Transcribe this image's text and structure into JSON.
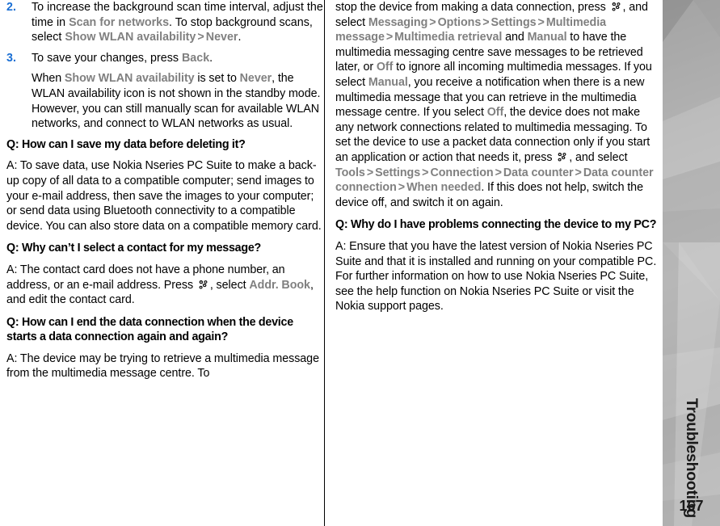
{
  "sidebar": {
    "chapter_title": "Troubleshooting",
    "page_number": "167",
    "icon": "faceted-gray-tab"
  },
  "document": {
    "icons": {
      "menu_key": "nokia-menu-key-icon"
    },
    "left_column": {
      "steps": [
        {
          "number": "2.",
          "parts": [
            {
              "type": "text",
              "value": "To increase the background scan time interval, adjust the time in "
            },
            {
              "type": "ui",
              "value": "Scan for networks"
            },
            {
              "type": "text",
              "value": ". To stop background scans, select "
            },
            {
              "type": "ui",
              "value": "Show WLAN availability"
            },
            {
              "type": "arrow",
              "value": ">"
            },
            {
              "type": "ui",
              "value": "Never"
            },
            {
              "type": "text",
              "value": "."
            }
          ]
        },
        {
          "number": "3.",
          "parts": [
            {
              "type": "text",
              "value": "To save your changes, press "
            },
            {
              "type": "ui",
              "value": "Back"
            },
            {
              "type": "text",
              "value": "."
            }
          ]
        }
      ],
      "step_note": [
        {
          "type": "text",
          "value": "When "
        },
        {
          "type": "ui",
          "value": "Show WLAN availability"
        },
        {
          "type": "text",
          "value": " is set to "
        },
        {
          "type": "ui",
          "value": "Never"
        },
        {
          "type": "text",
          "value": ", the WLAN availability icon is not shown in the standby mode. However, you can still manually scan for available WLAN networks, and connect to WLAN networks as usual."
        }
      ],
      "qa": [
        {
          "question": "Q: How can I save my data before deleting it?",
          "answer": [
            {
              "type": "text",
              "value": "A: To save data, use Nokia Nseries PC Suite to make a back-up copy of all data to a compatible computer; send images to your e-mail address, then save the images to your computer; or send data using Bluetooth connectivity to a compatible device. You can also store data on a compatible memory card."
            }
          ]
        },
        {
          "question": "Q: Why can’t I select a contact for my message?",
          "answer": [
            {
              "type": "text",
              "value": "A: The contact card does not have a phone number, an address, or an e-mail address. Press "
            },
            {
              "type": "icon",
              "value": "menu-key-icon"
            },
            {
              "type": "text",
              "value": ", select "
            },
            {
              "type": "ui",
              "value": "Addr. Book"
            },
            {
              "type": "text",
              "value": ", and edit the contact card."
            }
          ]
        },
        {
          "question": "Q: How can I end the data connection when the device starts a data connection again and again?",
          "answer": [
            {
              "type": "text",
              "value": "A: The device may be trying to retrieve a multimedia message from the multimedia message centre. To"
            }
          ]
        }
      ]
    },
    "right_column": {
      "continuation": [
        {
          "type": "text",
          "value": "stop the device from making a data connection, press "
        },
        {
          "type": "icon",
          "value": "menu-key-icon"
        },
        {
          "type": "text",
          "value": ", and select "
        },
        {
          "type": "ui",
          "value": "Messaging"
        },
        {
          "type": "arrow",
          "value": ">"
        },
        {
          "type": "ui",
          "value": "Options"
        },
        {
          "type": "arrow",
          "value": ">"
        },
        {
          "type": "ui",
          "value": "Settings"
        },
        {
          "type": "arrow",
          "value": ">"
        },
        {
          "type": "ui",
          "value": "Multimedia message"
        },
        {
          "type": "arrow",
          "value": ">"
        },
        {
          "type": "ui",
          "value": "Multimedia retrieval"
        },
        {
          "type": "text",
          "value": " and "
        },
        {
          "type": "ui",
          "value": "Manual"
        },
        {
          "type": "text",
          "value": " to have the multimedia messaging centre save messages to be retrieved later, or "
        },
        {
          "type": "ui",
          "value": "Off"
        },
        {
          "type": "text",
          "value": " to ignore all incoming multimedia messages. If you select "
        },
        {
          "type": "ui",
          "value": "Manual"
        },
        {
          "type": "text",
          "value": ", you receive a notification when there is a new multimedia message that you can retrieve in the multimedia message centre. If you select "
        },
        {
          "type": "ui",
          "value": "Off"
        },
        {
          "type": "text",
          "value": ", the device does not make any network connections related to multimedia messaging. To set the device to use a packet data connection only if you start an application or action that needs it, press "
        },
        {
          "type": "icon",
          "value": "menu-key-icon"
        },
        {
          "type": "text",
          "value": ", and select "
        },
        {
          "type": "ui",
          "value": "Tools"
        },
        {
          "type": "arrow",
          "value": ">"
        },
        {
          "type": "ui",
          "value": "Settings"
        },
        {
          "type": "arrow",
          "value": ">"
        },
        {
          "type": "ui",
          "value": "Connection"
        },
        {
          "type": "arrow",
          "value": ">"
        },
        {
          "type": "ui",
          "value": "Data counter"
        },
        {
          "type": "arrow",
          "value": ">"
        },
        {
          "type": "ui",
          "value": "Data counter connection"
        },
        {
          "type": "arrow",
          "value": ">"
        },
        {
          "type": "ui",
          "value": "When needed"
        },
        {
          "type": "text",
          "value": ". If this does not help, switch the device off, and switch it on again."
        }
      ],
      "qa": [
        {
          "question": "Q: Why do I have problems connecting the device to my PC?",
          "answer": [
            {
              "type": "text",
              "value": "A: Ensure that you have the latest version of Nokia Nseries PC Suite and that it is installed and running on your compatible PC. For further information on how to use Nokia Nseries PC Suite, see the help function on Nokia Nseries PC Suite or visit the Nokia support pages."
            }
          ]
        }
      ]
    }
  },
  "colors": {
    "step_number": "#1a6fd4",
    "ui_term": "#808080",
    "body_text": "#000000",
    "sidebar_tab": "#b8b8b8"
  }
}
